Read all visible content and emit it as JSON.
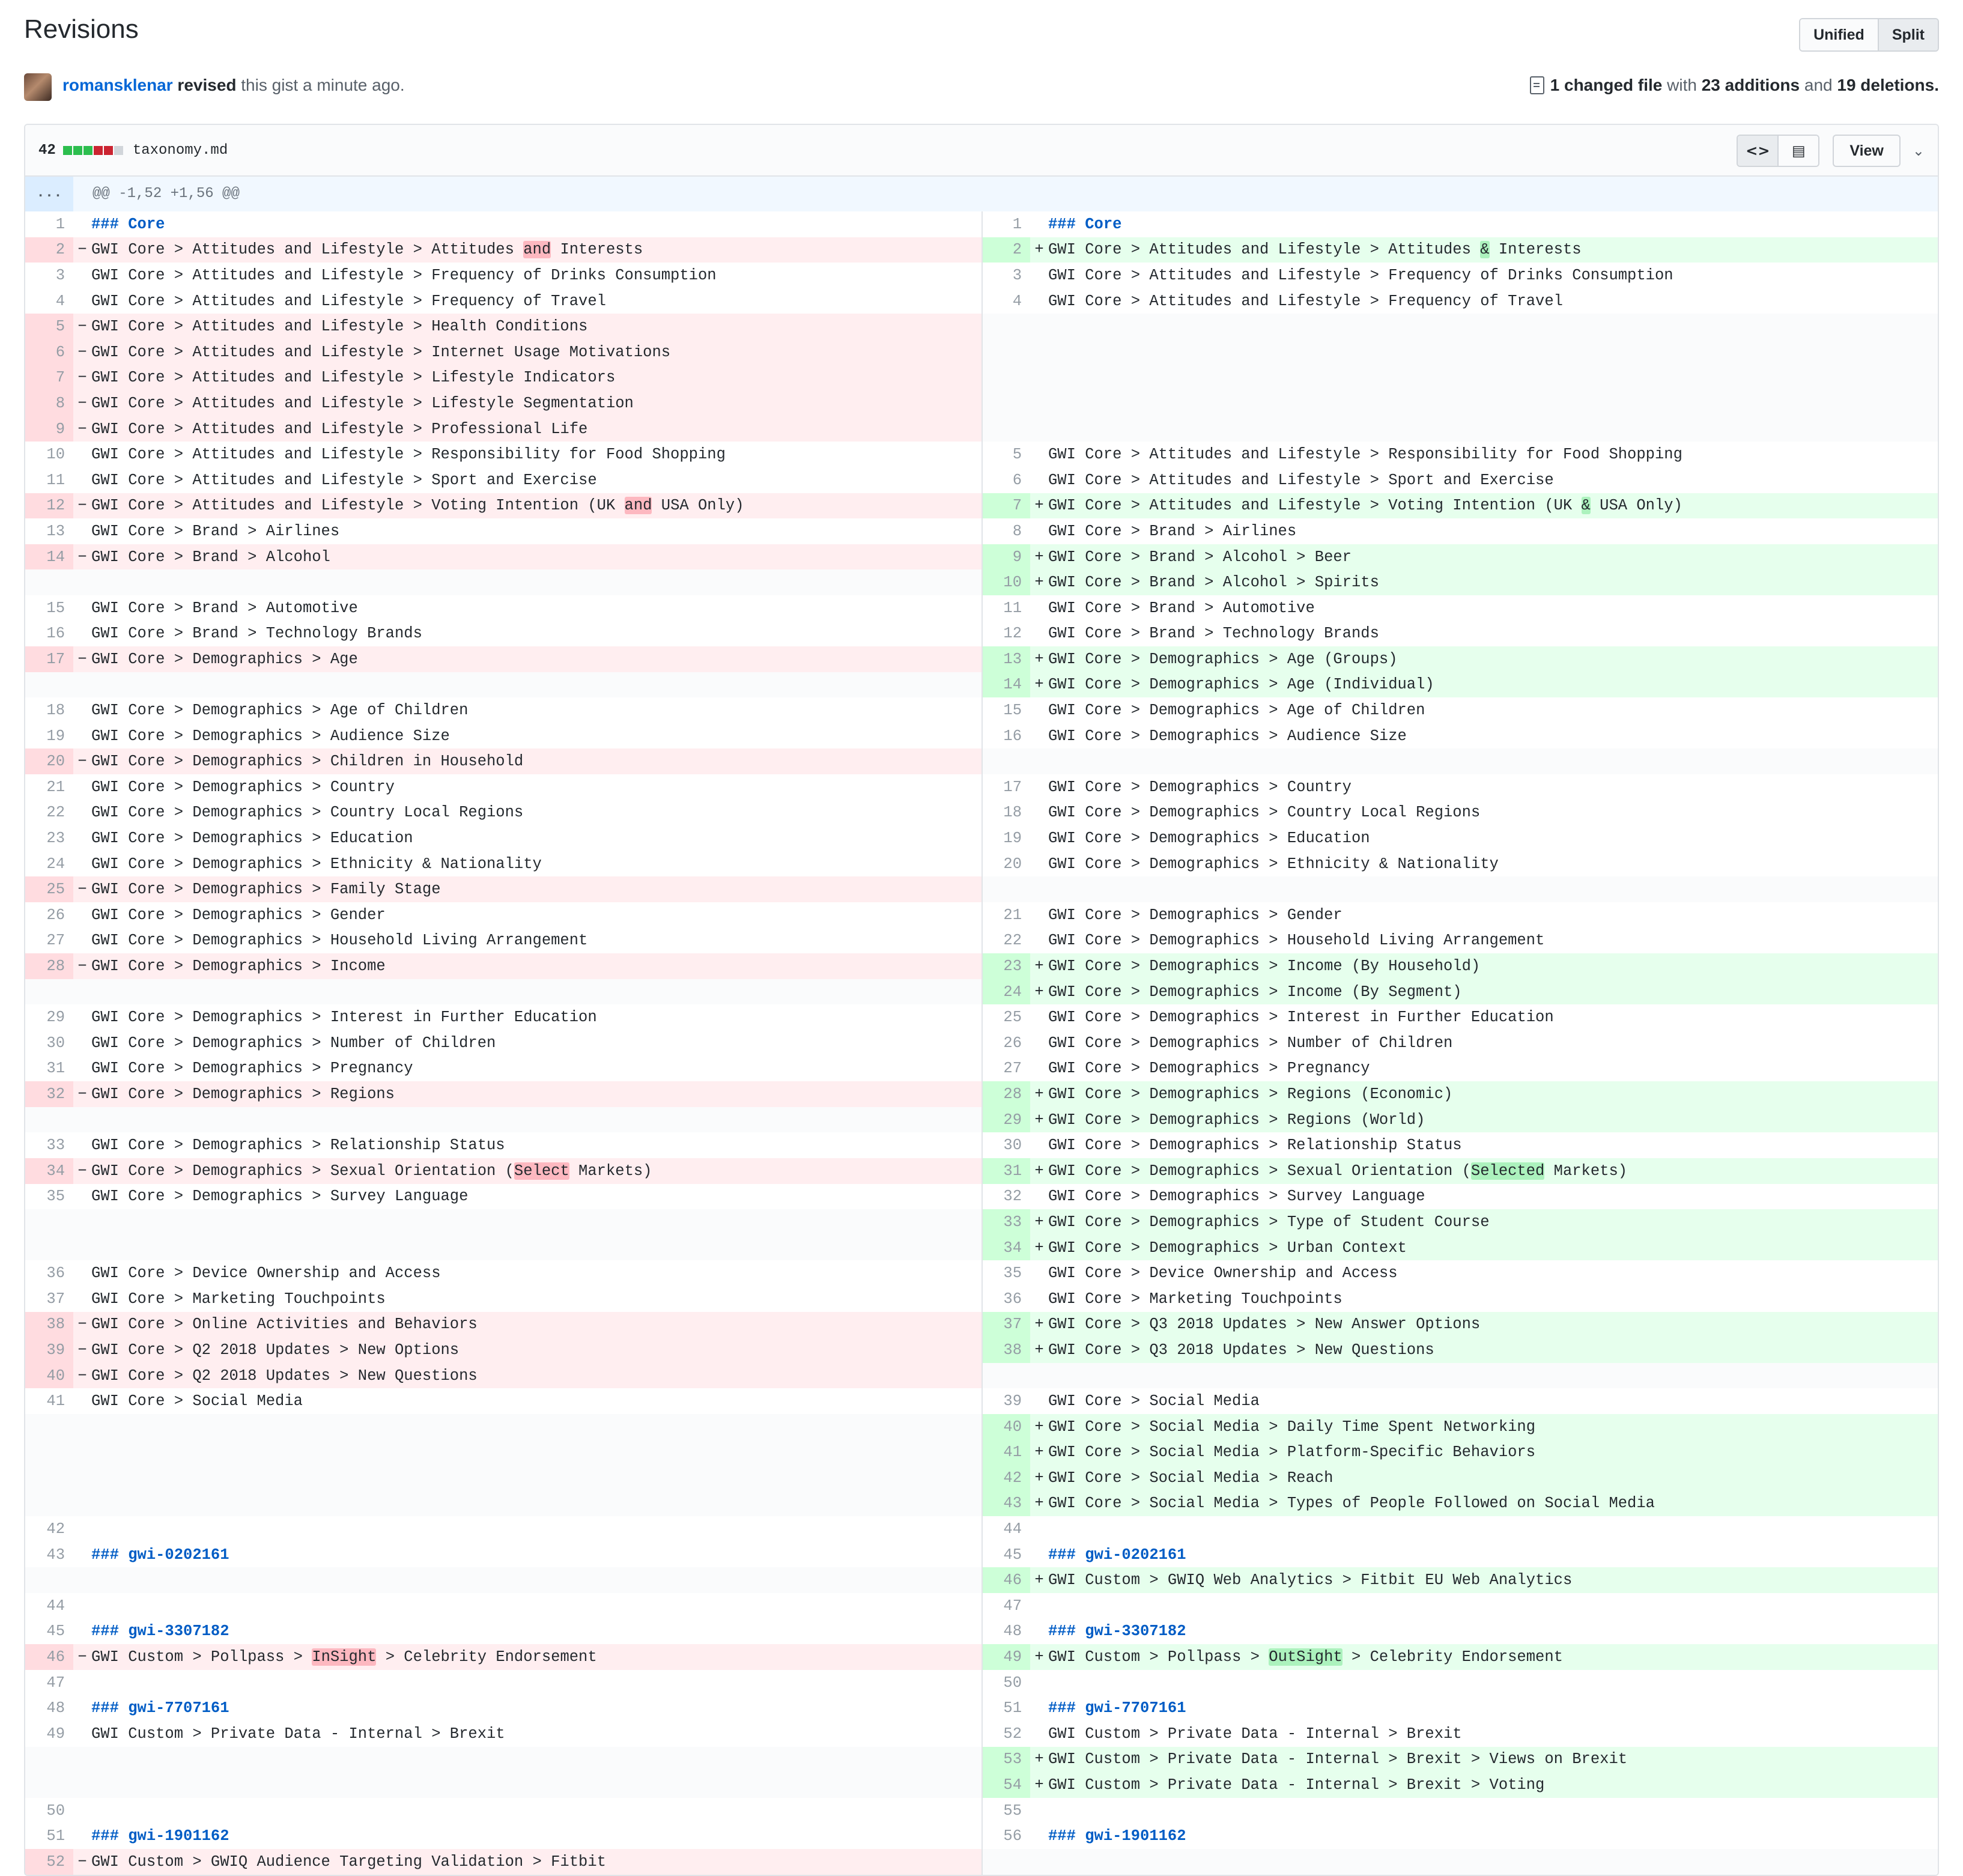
{
  "header": {
    "title": "Revisions",
    "view_modes": [
      "Unified",
      "Split"
    ],
    "active_view_mode": "Split"
  },
  "revision": {
    "user": "romansklenar",
    "verb": "revised",
    "rest": "this gist a minute ago.",
    "summary": {
      "files_text": "1 changed file",
      "with": "with",
      "additions_text": "23 additions",
      "and": "and",
      "deletions_text": "19 deletions."
    }
  },
  "file": {
    "changes_count": "42",
    "diffstat": [
      "add",
      "add",
      "add",
      "del",
      "del",
      "neutral"
    ],
    "name": "taxonomy.md",
    "icons": [
      "code-icon",
      "file-text-icon"
    ],
    "view_label": "View",
    "hunk_expand": "...",
    "hunk_header": "@@ -1,52 +1,56 @@"
  },
  "colors": {
    "accent": "#0366d6",
    "del_bg": "#ffeef0",
    "add_bg": "#e6ffed",
    "del_word": "#fdb8c0",
    "add_word": "#acf2bd"
  },
  "rows": [
    {
      "l": {
        "n": "1",
        "t": "### Core",
        "h": 1
      },
      "r": {
        "n": "1",
        "t": "### Core",
        "h": 1
      }
    },
    {
      "l": {
        "n": "2",
        "k": "d",
        "p": [
          "GWI Core > Attitudes and Lifestyle > Attitudes ",
          {
            "w": "and"
          },
          " Interests"
        ]
      },
      "r": {
        "n": "2",
        "k": "a",
        "p": [
          "GWI Core > Attitudes and Lifestyle > Attitudes ",
          {
            "w": "&"
          },
          " Interests"
        ]
      }
    },
    {
      "l": {
        "n": "3",
        "t": "GWI Core > Attitudes and Lifestyle > Frequency of Drinks Consumption"
      },
      "r": {
        "n": "3",
        "t": "GWI Core > Attitudes and Lifestyle > Frequency of Drinks Consumption"
      }
    },
    {
      "l": {
        "n": "4",
        "t": "GWI Core > Attitudes and Lifestyle > Frequency of Travel"
      },
      "r": {
        "n": "4",
        "t": "GWI Core > Attitudes and Lifestyle > Frequency of Travel"
      }
    },
    {
      "l": {
        "n": "5",
        "k": "d",
        "t": "GWI Core > Attitudes and Lifestyle > Health Conditions"
      },
      "r": null
    },
    {
      "l": {
        "n": "6",
        "k": "d",
        "t": "GWI Core > Attitudes and Lifestyle > Internet Usage Motivations"
      },
      "r": null
    },
    {
      "l": {
        "n": "7",
        "k": "d",
        "t": "GWI Core > Attitudes and Lifestyle > Lifestyle Indicators"
      },
      "r": null
    },
    {
      "l": {
        "n": "8",
        "k": "d",
        "t": "GWI Core > Attitudes and Lifestyle > Lifestyle Segmentation"
      },
      "r": null
    },
    {
      "l": {
        "n": "9",
        "k": "d",
        "t": "GWI Core > Attitudes and Lifestyle > Professional Life"
      },
      "r": null
    },
    {
      "l": {
        "n": "10",
        "t": "GWI Core > Attitudes and Lifestyle > Responsibility for Food Shopping"
      },
      "r": {
        "n": "5",
        "t": "GWI Core > Attitudes and Lifestyle > Responsibility for Food Shopping"
      }
    },
    {
      "l": {
        "n": "11",
        "t": "GWI Core > Attitudes and Lifestyle > Sport and Exercise"
      },
      "r": {
        "n": "6",
        "t": "GWI Core > Attitudes and Lifestyle > Sport and Exercise"
      }
    },
    {
      "l": {
        "n": "12",
        "k": "d",
        "p": [
          "GWI Core > Attitudes and Lifestyle > Voting Intention (UK ",
          {
            "w": "and"
          },
          " USA Only)"
        ]
      },
      "r": {
        "n": "7",
        "k": "a",
        "p": [
          "GWI Core > Attitudes and Lifestyle > Voting Intention (UK ",
          {
            "w": "&"
          },
          " USA Only)"
        ]
      }
    },
    {
      "l": {
        "n": "13",
        "t": "GWI Core > Brand > Airlines"
      },
      "r": {
        "n": "8",
        "t": "GWI Core > Brand > Airlines"
      }
    },
    {
      "l": {
        "n": "14",
        "k": "d",
        "t": "GWI Core > Brand > Alcohol"
      },
      "r": {
        "n": "9",
        "k": "a",
        "t": "GWI Core > Brand > Alcohol > Beer"
      }
    },
    {
      "l": null,
      "r": {
        "n": "10",
        "k": "a",
        "t": "GWI Core > Brand > Alcohol > Spirits"
      }
    },
    {
      "l": {
        "n": "15",
        "t": "GWI Core > Brand > Automotive"
      },
      "r": {
        "n": "11",
        "t": "GWI Core > Brand > Automotive"
      }
    },
    {
      "l": {
        "n": "16",
        "t": "GWI Core > Brand > Technology Brands"
      },
      "r": {
        "n": "12",
        "t": "GWI Core > Brand > Technology Brands"
      }
    },
    {
      "l": {
        "n": "17",
        "k": "d",
        "t": "GWI Core > Demographics > Age"
      },
      "r": {
        "n": "13",
        "k": "a",
        "t": "GWI Core > Demographics > Age (Groups)"
      }
    },
    {
      "l": null,
      "r": {
        "n": "14",
        "k": "a",
        "t": "GWI Core > Demographics > Age (Individual)"
      }
    },
    {
      "l": {
        "n": "18",
        "t": "GWI Core > Demographics > Age of Children"
      },
      "r": {
        "n": "15",
        "t": "GWI Core > Demographics > Age of Children"
      }
    },
    {
      "l": {
        "n": "19",
        "t": "GWI Core > Demographics > Audience Size"
      },
      "r": {
        "n": "16",
        "t": "GWI Core > Demographics > Audience Size"
      }
    },
    {
      "l": {
        "n": "20",
        "k": "d",
        "t": "GWI Core > Demographics > Children in Household"
      },
      "r": null
    },
    {
      "l": {
        "n": "21",
        "t": "GWI Core > Demographics > Country"
      },
      "r": {
        "n": "17",
        "t": "GWI Core > Demographics > Country"
      }
    },
    {
      "l": {
        "n": "22",
        "t": "GWI Core > Demographics > Country Local Regions"
      },
      "r": {
        "n": "18",
        "t": "GWI Core > Demographics > Country Local Regions"
      }
    },
    {
      "l": {
        "n": "23",
        "t": "GWI Core > Demographics > Education"
      },
      "r": {
        "n": "19",
        "t": "GWI Core > Demographics > Education"
      }
    },
    {
      "l": {
        "n": "24",
        "t": "GWI Core > Demographics > Ethnicity & Nationality"
      },
      "r": {
        "n": "20",
        "t": "GWI Core > Demographics > Ethnicity & Nationality"
      }
    },
    {
      "l": {
        "n": "25",
        "k": "d",
        "t": "GWI Core > Demographics > Family Stage"
      },
      "r": null
    },
    {
      "l": {
        "n": "26",
        "t": "GWI Core > Demographics > Gender"
      },
      "r": {
        "n": "21",
        "t": "GWI Core > Demographics > Gender"
      }
    },
    {
      "l": {
        "n": "27",
        "t": "GWI Core > Demographics > Household Living Arrangement"
      },
      "r": {
        "n": "22",
        "t": "GWI Core > Demographics > Household Living Arrangement"
      }
    },
    {
      "l": {
        "n": "28",
        "k": "d",
        "t": "GWI Core > Demographics > Income"
      },
      "r": {
        "n": "23",
        "k": "a",
        "t": "GWI Core > Demographics > Income (By Household)"
      }
    },
    {
      "l": null,
      "r": {
        "n": "24",
        "k": "a",
        "t": "GWI Core > Demographics > Income (By Segment)"
      }
    },
    {
      "l": {
        "n": "29",
        "t": "GWI Core > Demographics > Interest in Further Education"
      },
      "r": {
        "n": "25",
        "t": "GWI Core > Demographics > Interest in Further Education"
      }
    },
    {
      "l": {
        "n": "30",
        "t": "GWI Core > Demographics > Number of Children"
      },
      "r": {
        "n": "26",
        "t": "GWI Core > Demographics > Number of Children"
      }
    },
    {
      "l": {
        "n": "31",
        "t": "GWI Core > Demographics > Pregnancy"
      },
      "r": {
        "n": "27",
        "t": "GWI Core > Demographics > Pregnancy"
      }
    },
    {
      "l": {
        "n": "32",
        "k": "d",
        "t": "GWI Core > Demographics > Regions"
      },
      "r": {
        "n": "28",
        "k": "a",
        "t": "GWI Core > Demographics > Regions (Economic)"
      }
    },
    {
      "l": null,
      "r": {
        "n": "29",
        "k": "a",
        "t": "GWI Core > Demographics > Regions (World)"
      }
    },
    {
      "l": {
        "n": "33",
        "t": "GWI Core > Demographics > Relationship Status"
      },
      "r": {
        "n": "30",
        "t": "GWI Core > Demographics > Relationship Status"
      }
    },
    {
      "l": {
        "n": "34",
        "k": "d",
        "p": [
          "GWI Core > Demographics > Sexual Orientation (",
          {
            "w": "Select"
          },
          " Markets)"
        ]
      },
      "r": {
        "n": "31",
        "k": "a",
        "p": [
          "GWI Core > Demographics > Sexual Orientation (",
          {
            "w": "Selected"
          },
          " Markets)"
        ]
      }
    },
    {
      "l": {
        "n": "35",
        "t": "GWI Core > Demographics > Survey Language"
      },
      "r": {
        "n": "32",
        "t": "GWI Core > Demographics > Survey Language"
      }
    },
    {
      "l": null,
      "r": {
        "n": "33",
        "k": "a",
        "t": "GWI Core > Demographics > Type of Student Course"
      }
    },
    {
      "l": null,
      "r": {
        "n": "34",
        "k": "a",
        "t": "GWI Core > Demographics > Urban Context"
      }
    },
    {
      "l": {
        "n": "36",
        "t": "GWI Core > Device Ownership and Access"
      },
      "r": {
        "n": "35",
        "t": "GWI Core > Device Ownership and Access"
      }
    },
    {
      "l": {
        "n": "37",
        "t": "GWI Core > Marketing Touchpoints"
      },
      "r": {
        "n": "36",
        "t": "GWI Core > Marketing Touchpoints"
      }
    },
    {
      "l": {
        "n": "38",
        "k": "d",
        "t": "GWI Core > Online Activities and Behaviors"
      },
      "r": {
        "n": "37",
        "k": "a",
        "t": "GWI Core > Q3 2018 Updates > New Answer Options"
      }
    },
    {
      "l": {
        "n": "39",
        "k": "d",
        "t": "GWI Core > Q2 2018 Updates > New Options"
      },
      "r": {
        "n": "38",
        "k": "a",
        "t": "GWI Core > Q3 2018 Updates > New Questions"
      }
    },
    {
      "l": {
        "n": "40",
        "k": "d",
        "t": "GWI Core > Q2 2018 Updates > New Questions"
      },
      "r": null
    },
    {
      "l": {
        "n": "41",
        "t": "GWI Core > Social Media"
      },
      "r": {
        "n": "39",
        "t": "GWI Core > Social Media"
      }
    },
    {
      "l": null,
      "r": {
        "n": "40",
        "k": "a",
        "t": "GWI Core > Social Media > Daily Time Spent Networking"
      }
    },
    {
      "l": null,
      "r": {
        "n": "41",
        "k": "a",
        "t": "GWI Core > Social Media > Platform-Specific Behaviors"
      }
    },
    {
      "l": null,
      "r": {
        "n": "42",
        "k": "a",
        "t": "GWI Core > Social Media > Reach"
      }
    },
    {
      "l": null,
      "r": {
        "n": "43",
        "k": "a",
        "t": "GWI Core > Social Media > Types of People Followed on Social Media"
      }
    },
    {
      "l": {
        "n": "42",
        "t": ""
      },
      "r": {
        "n": "44",
        "t": ""
      }
    },
    {
      "l": {
        "n": "43",
        "t": "### gwi-0202161",
        "h": 1
      },
      "r": {
        "n": "45",
        "t": "### gwi-0202161",
        "h": 1
      }
    },
    {
      "l": null,
      "r": {
        "n": "46",
        "k": "a",
        "t": "GWI Custom > GWIQ Web Analytics > Fitbit EU Web Analytics"
      }
    },
    {
      "l": {
        "n": "44",
        "t": ""
      },
      "r": {
        "n": "47",
        "t": ""
      }
    },
    {
      "l": {
        "n": "45",
        "t": "### gwi-3307182",
        "h": 1
      },
      "r": {
        "n": "48",
        "t": "### gwi-3307182",
        "h": 1
      }
    },
    {
      "l": {
        "n": "46",
        "k": "d",
        "p": [
          "GWI Custom > Pollpass > ",
          {
            "w": "InSight"
          },
          " > Celebrity Endorsement"
        ]
      },
      "r": {
        "n": "49",
        "k": "a",
        "p": [
          "GWI Custom > Pollpass > ",
          {
            "w": "OutSight"
          },
          " > Celebrity Endorsement"
        ]
      }
    },
    {
      "l": {
        "n": "47",
        "t": ""
      },
      "r": {
        "n": "50",
        "t": ""
      }
    },
    {
      "l": {
        "n": "48",
        "t": "### gwi-7707161",
        "h": 1
      },
      "r": {
        "n": "51",
        "t": "### gwi-7707161",
        "h": 1
      }
    },
    {
      "l": {
        "n": "49",
        "t": "GWI Custom > Private Data - Internal > Brexit"
      },
      "r": {
        "n": "52",
        "t": "GWI Custom > Private Data - Internal > Brexit"
      }
    },
    {
      "l": null,
      "r": {
        "n": "53",
        "k": "a",
        "t": "GWI Custom > Private Data - Internal > Brexit > Views on Brexit"
      }
    },
    {
      "l": null,
      "r": {
        "n": "54",
        "k": "a",
        "t": "GWI Custom > Private Data - Internal > Brexit > Voting"
      }
    },
    {
      "l": {
        "n": "50",
        "t": ""
      },
      "r": {
        "n": "55",
        "t": ""
      }
    },
    {
      "l": {
        "n": "51",
        "t": "### gwi-1901162",
        "h": 1
      },
      "r": {
        "n": "56",
        "t": "### gwi-1901162",
        "h": 1
      }
    },
    {
      "l": {
        "n": "52",
        "k": "d",
        "t": "GWI Custom > GWIQ Audience Targeting Validation > Fitbit"
      },
      "r": null
    }
  ]
}
